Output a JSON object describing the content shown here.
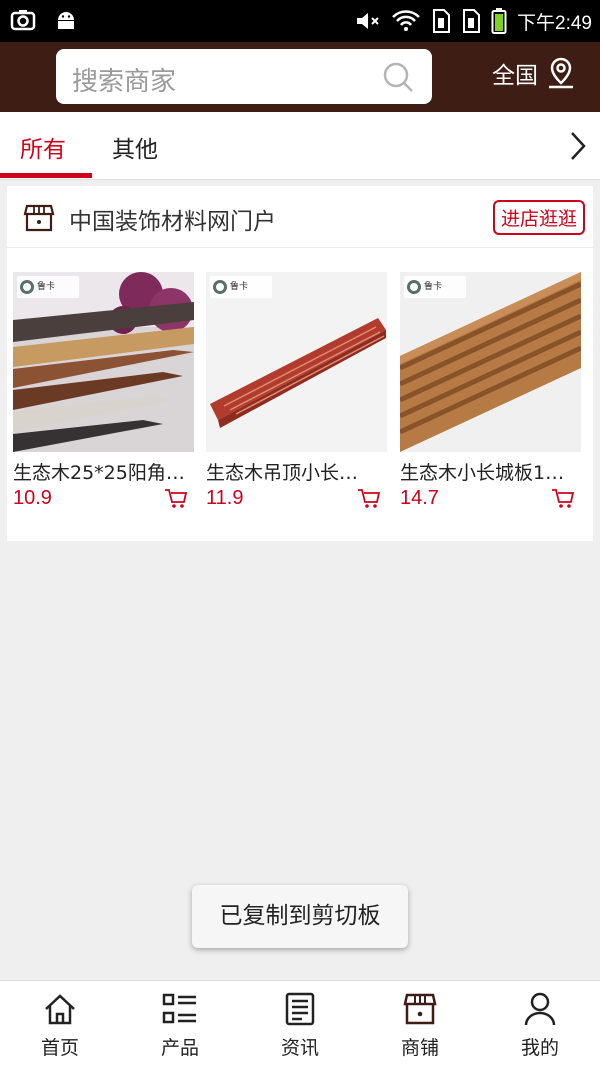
{
  "status_bar": {
    "time": "下午2:49"
  },
  "header": {
    "search_placeholder": "搜索商家",
    "region_label": "全国"
  },
  "tabs": [
    {
      "label": "所有",
      "active": true
    },
    {
      "label": "其他",
      "active": false
    }
  ],
  "shop": {
    "name": "中国装饰材料网门户",
    "enter_label": "进店逛逛"
  },
  "products": [
    {
      "title": "生态木25*25阳角…",
      "price": "10.9",
      "logo": "鲁卡"
    },
    {
      "title": "生态木吊顶小长…",
      "price": "11.9",
      "logo": "鲁卡"
    },
    {
      "title": "生态木小长城板1…",
      "price": "14.7",
      "logo": "鲁卡"
    }
  ],
  "toast": "已复制到剪切板",
  "bottom_nav": [
    {
      "label": "首页",
      "icon": "home-icon"
    },
    {
      "label": "产品",
      "icon": "list-icon"
    },
    {
      "label": "资讯",
      "icon": "news-icon"
    },
    {
      "label": "商铺",
      "icon": "shop-icon"
    },
    {
      "label": "我的",
      "icon": "user-icon"
    }
  ],
  "colors": {
    "header_bg": "#3e1d14",
    "accent": "#d0021b",
    "page_bg": "#efefef"
  }
}
